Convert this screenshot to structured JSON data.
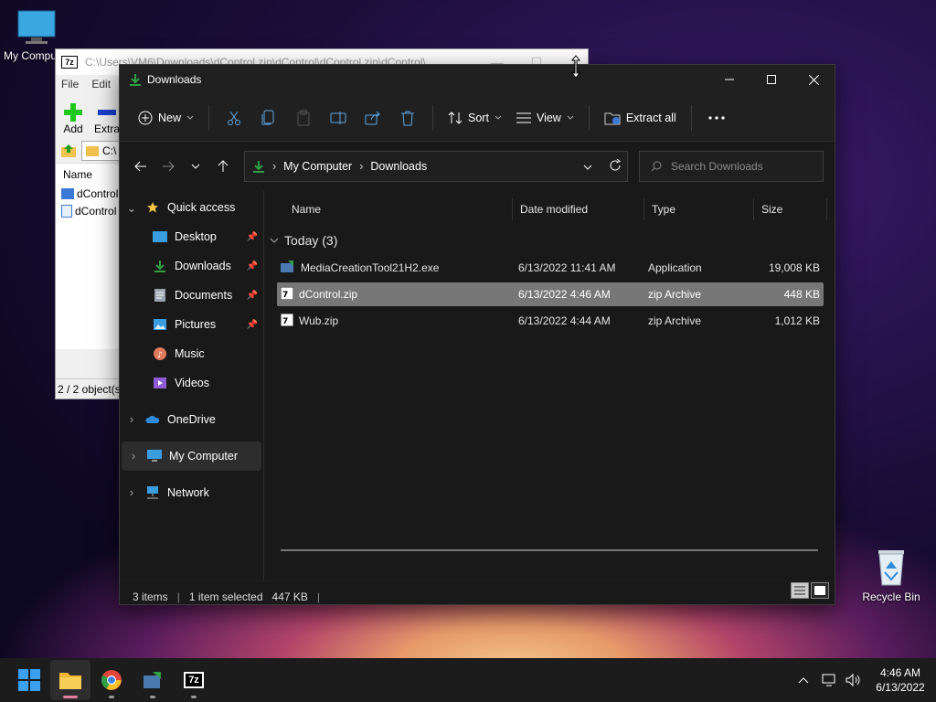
{
  "desktop": {
    "my_computer_label": "My Computer",
    "recycle_bin_label": "Recycle Bin"
  },
  "zip_window": {
    "logo": "7z",
    "title": "C:\\Users\\VM6\\Downloads\\dControl.zip\\dControl\\dControl.zip\\dControl\\",
    "menu": [
      "File",
      "Edit"
    ],
    "add_label": "Add",
    "extract_label": "Extra",
    "path_value": "C:\\",
    "col_name": "Name",
    "items": [
      "dControl",
      "dControl"
    ],
    "status": "2 / 2 object(s)"
  },
  "explorer": {
    "title": "Downloads",
    "toolbar": {
      "new_label": "New",
      "sort_label": "Sort",
      "view_label": "View",
      "extract_all_label": "Extract all"
    },
    "address": {
      "crumbs": [
        "My Computer",
        "Downloads"
      ]
    },
    "search": {
      "placeholder": "Search Downloads"
    },
    "nav": {
      "quick_access": "Quick access",
      "items": [
        {
          "label": "Desktop",
          "icon": "desktop-icon",
          "pinned": true
        },
        {
          "label": "Downloads",
          "icon": "downloads-icon",
          "pinned": true
        },
        {
          "label": "Documents",
          "icon": "documents-icon",
          "pinned": true
        },
        {
          "label": "Pictures",
          "icon": "pictures-icon",
          "pinned": true
        },
        {
          "label": "Music",
          "icon": "music-icon",
          "pinned": false
        },
        {
          "label": "Videos",
          "icon": "videos-icon",
          "pinned": false
        }
      ],
      "onedrive": "OneDrive",
      "my_computer": "My Computer",
      "network": "Network"
    },
    "columns": [
      "Name",
      "Date modified",
      "Type",
      "Size"
    ],
    "group_label": "Today (3)",
    "files": [
      {
        "name": "MediaCreationTool21H2.exe",
        "date": "6/13/2022 11:41 AM",
        "type": "Application",
        "size": "19,008 KB",
        "icon": "installer-icon",
        "selected": false
      },
      {
        "name": "dControl.zip",
        "date": "6/13/2022 4:46 AM",
        "type": "zip Archive",
        "size": "448 KB",
        "icon": "7zip-archive-icon",
        "selected": true
      },
      {
        "name": "Wub.zip",
        "date": "6/13/2022 4:44 AM",
        "type": "zip Archive",
        "size": "1,012 KB",
        "icon": "7zip-archive-icon",
        "selected": false
      }
    ],
    "status": {
      "items": "3 items",
      "selected": "1 item selected",
      "size": "447 KB"
    }
  },
  "taskbar": {
    "apps": [
      "start",
      "file-explorer",
      "chrome",
      "media-creation-tool",
      "7zip"
    ],
    "tray_time": "4:46 AM",
    "tray_date": "6/13/2022",
    "zip_logo": "7z"
  },
  "colors": {
    "explorer_bg": "#191919",
    "selection": "#777777",
    "accent_green": "#2ea043",
    "folder_yellow": "#f5c542"
  }
}
